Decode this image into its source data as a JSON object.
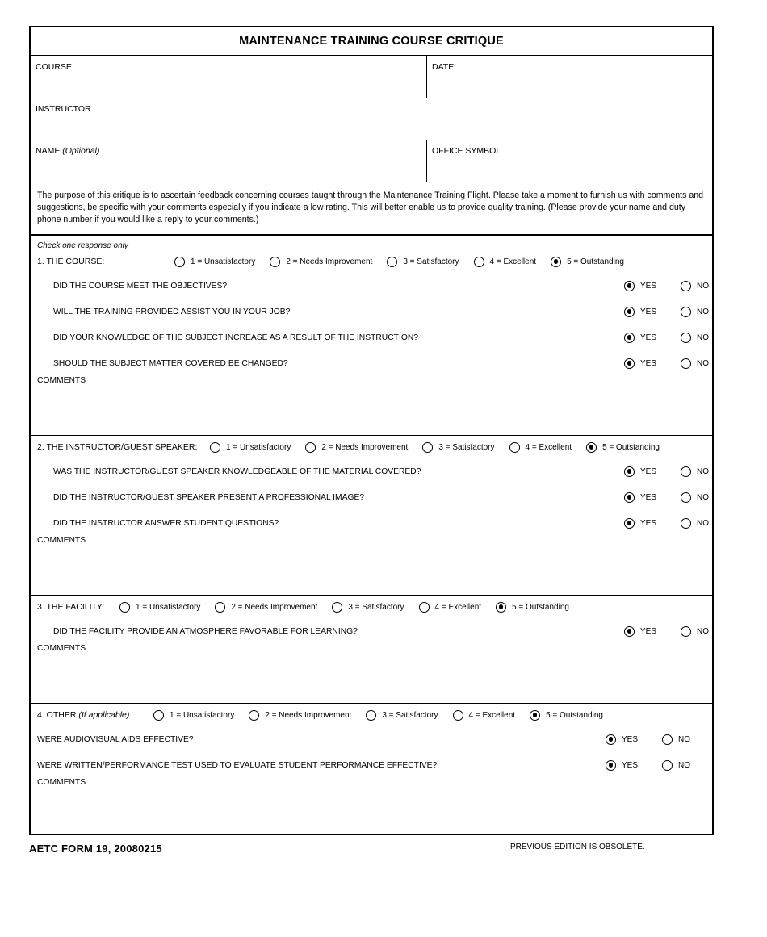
{
  "form": {
    "title": "MAINTENANCE TRAINING COURSE CRITIQUE",
    "header_fields": {
      "course": "COURSE",
      "date": "DATE",
      "instructor": "INSTRUCTOR",
      "name": "NAME",
      "name_optional": "(Optional)",
      "office_symbol": "OFFICE SYMBOL"
    },
    "purpose": "The purpose of this critique is to ascertain feedback concerning courses taught through the Maintenance Training Flight. Please take a moment to furnish us with comments and suggestions, be specific with your comments especially if you indicate a low rating. This will better enable us to provide quality training. (Please provide your name and duty phone number if you would like a reply to your comments.)",
    "check_note": "Check one response only",
    "comments_label": "COMMENTS",
    "yes_label": "YES",
    "no_label": "NO",
    "scale": [
      {
        "label": "1 = Unsatisfactory",
        "value": 1
      },
      {
        "label": "2 = Needs Improvement",
        "value": 2
      },
      {
        "label": "3 = Satisfactory",
        "value": 3
      },
      {
        "label": "4 = Excellent",
        "value": 4
      },
      {
        "label": "5 = Outstanding",
        "value": 5
      }
    ],
    "sections": [
      {
        "number": "1.",
        "label": "THE COURSE:",
        "label_italic": "",
        "selected_rating": 5,
        "questions": [
          {
            "text": "DID THE COURSE MEET THE OBJECTIVES?",
            "answer": "YES"
          },
          {
            "text": "WILL THE TRAINING PROVIDED ASSIST YOU IN YOUR JOB?",
            "answer": "YES"
          },
          {
            "text": "DID YOUR KNOWLEDGE OF THE SUBJECT INCREASE AS A RESULT OF THE INSTRUCTION?",
            "answer": "YES"
          },
          {
            "text": "SHOULD THE SUBJECT MATTER COVERED BE CHANGED?",
            "answer": "YES"
          }
        ]
      },
      {
        "number": "2.",
        "label": "THE INSTRUCTOR/GUEST SPEAKER:",
        "label_italic": "",
        "selected_rating": 5,
        "questions": [
          {
            "text": "WAS THE INSTRUCTOR/GUEST SPEAKER KNOWLEDGEABLE OF THE MATERIAL COVERED?",
            "answer": "YES"
          },
          {
            "text": "DID THE INSTRUCTOR/GUEST SPEAKER PRESENT A PROFESSIONAL IMAGE?",
            "answer": "YES"
          },
          {
            "text": "DID THE INSTRUCTOR ANSWER STUDENT QUESTIONS?",
            "answer": "YES"
          }
        ]
      },
      {
        "number": "3.",
        "label": "THE FACILITY:",
        "label_italic": "",
        "selected_rating": 5,
        "questions": [
          {
            "text": "DID THE FACILITY PROVIDE AN ATMOSPHERE FAVORABLE FOR LEARNING?",
            "answer": "YES"
          }
        ]
      },
      {
        "number": "4.",
        "label": "OTHER",
        "label_italic": "(If applicable)",
        "selected_rating": 5,
        "questions": [
          {
            "text": "WERE AUDIOVISUAL AIDS EFFECTIVE?",
            "answer": "YES"
          },
          {
            "text": "WERE WRITTEN/PERFORMANCE TEST USED TO EVALUATE STUDENT PERFORMANCE EFFECTIVE?",
            "answer": "YES"
          }
        ]
      }
    ],
    "footer": {
      "form_id": "AETC FORM 19, 20080215",
      "note": "PREVIOUS EDITION IS OBSOLETE."
    }
  }
}
